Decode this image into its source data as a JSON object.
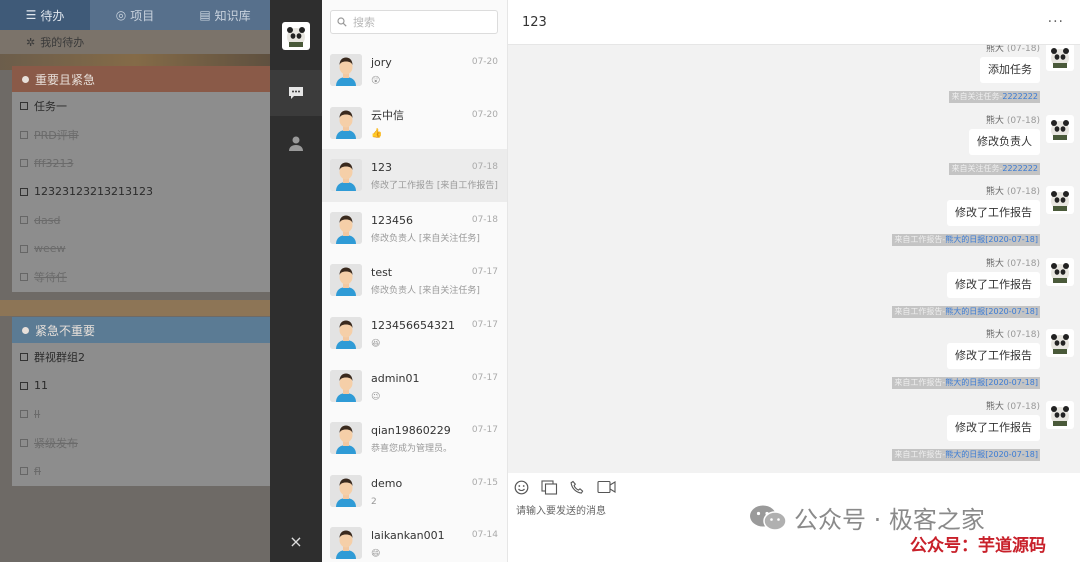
{
  "left_panel": {
    "tabs": [
      {
        "label": "待办",
        "icon": "list-icon"
      },
      {
        "label": "项目",
        "icon": "compass-icon"
      },
      {
        "label": "知识库",
        "icon": "book-icon"
      }
    ],
    "subhead": "我的待办",
    "groups": [
      {
        "title": "重要且紧急",
        "color": "#8a5a48",
        "items": [
          {
            "label": "任务一",
            "done": false
          },
          {
            "label": "PRD评审",
            "done": true
          },
          {
            "label": "fff3213",
            "done": true
          },
          {
            "label": "12323123213213123",
            "done": false
          },
          {
            "label": "dasd",
            "done": true
          },
          {
            "label": "weew",
            "done": true
          },
          {
            "label": "等待任",
            "done": true
          }
        ]
      },
      {
        "title": "紧急不重要",
        "color": "#5b7b94",
        "items": [
          {
            "label": "群视群组2",
            "done": false
          },
          {
            "label": "11",
            "done": false
          },
          {
            "label": "ll",
            "done": true
          },
          {
            "label": "紧级发布",
            "done": true
          },
          {
            "label": "fl",
            "done": true
          }
        ]
      }
    ]
  },
  "icon_bar": {
    "nav": [
      {
        "name": "chat",
        "icon": "chat-icon",
        "active": true
      },
      {
        "name": "contacts",
        "icon": "person-icon",
        "active": false
      }
    ],
    "close_glyph": "×"
  },
  "contacts": {
    "search_placeholder": "搜索",
    "items": [
      {
        "name": "jory",
        "date": "07-20",
        "preview": "😲",
        "active": false
      },
      {
        "name": "云中信",
        "date": "07-20",
        "preview": "👍",
        "active": false
      },
      {
        "name": "123",
        "date": "07-18",
        "preview": "修改了工作报告 [来自工作报告]",
        "active": true
      },
      {
        "name": "123456",
        "date": "07-18",
        "preview": "修改负责人 [来自关注任务]",
        "active": false
      },
      {
        "name": "test",
        "date": "07-17",
        "preview": "修改负责人 [来自关注任务]",
        "active": false
      },
      {
        "name": "123456654321",
        "date": "07-17",
        "preview": "😆",
        "active": false
      },
      {
        "name": "admin01",
        "date": "07-17",
        "preview": "😉",
        "active": false
      },
      {
        "name": "qian19860229",
        "date": "07-17",
        "preview": "恭喜您成为管理员。",
        "active": false
      },
      {
        "name": "demo",
        "date": "07-15",
        "preview": "2",
        "active": false
      },
      {
        "name": "laikankan001",
        "date": "07-14",
        "preview": "😄",
        "active": false
      }
    ]
  },
  "chat": {
    "title": "123",
    "more": "···",
    "messages": [
      {
        "sender": "熊大",
        "time": "(07-18)",
        "text": "添加任务",
        "src_label": "来自关注任务-",
        "src_link": "2222222"
      },
      {
        "sender": "熊大",
        "time": "(07-18)",
        "text": "修改负责人",
        "src_label": "来自关注任务-",
        "src_link": "2222222"
      },
      {
        "sender": "熊大",
        "time": "(07-18)",
        "text": "修改了工作报告",
        "src_label": "来自工作报告-",
        "src_link": "熊大的日报[2020-07-18]"
      },
      {
        "sender": "熊大",
        "time": "(07-18)",
        "text": "修改了工作报告",
        "src_label": "来自工作报告-",
        "src_link": "熊大的日报[2020-07-18]"
      },
      {
        "sender": "熊大",
        "time": "(07-18)",
        "text": "修改了工作报告",
        "src_label": "来自工作报告-",
        "src_link": "熊大的日报[2020-07-18]"
      },
      {
        "sender": "熊大",
        "time": "(07-18)",
        "text": "修改了工作报告",
        "src_label": "来自工作报告-",
        "src_link": "熊大的日报[2020-07-18]"
      }
    ],
    "toolbar": [
      {
        "name": "emoji-button",
        "icon": "smile-icon"
      },
      {
        "name": "screenshot-button",
        "icon": "copy-icon"
      },
      {
        "name": "voice-call-button",
        "icon": "phone-icon"
      },
      {
        "name": "video-call-button",
        "icon": "video-icon"
      }
    ],
    "input_placeholder": "请输入要发送的消息"
  },
  "watermark": {
    "line1": "公众号 · 极客之家",
    "line2": "公众号：芋道源码",
    "line2_color": "#c8202a"
  }
}
